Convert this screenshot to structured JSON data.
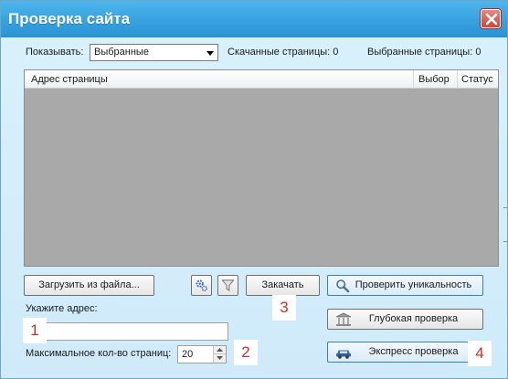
{
  "window": {
    "title": "Проверка сайта"
  },
  "filter": {
    "label": "Показывать:",
    "selected": "Выбранные"
  },
  "counters": {
    "downloaded": "Скачанные страницы: 0",
    "selected": "Выбранные страницы: 0"
  },
  "list": {
    "columns": [
      "Адрес страницы",
      "Выбор",
      "Статус"
    ]
  },
  "buttons": {
    "load_from_file": "Загрузить из файла...",
    "download": "Закачать",
    "check_uniqueness": "Проверить уникальность",
    "deep_check": "Глубокая проверка",
    "express_check": "Экспресс проверка"
  },
  "address": {
    "label": "Укажите адрес:",
    "value": ""
  },
  "max_pages": {
    "label": "Максимальное кол-во страниц:",
    "value": "20"
  },
  "annotations": [
    "1",
    "2",
    "3",
    "4"
  ],
  "colors": {
    "titlebar": "#37a2e0",
    "close": "#c9463a",
    "list_bg": "#a9a9a9",
    "annotation": "#d22c2c"
  },
  "icons": {
    "close": "close-icon",
    "settings": "gear-icon",
    "filter": "filter-icon",
    "check_uniqueness": "magnifier-icon",
    "deep_check": "bank-icon",
    "express_check": "car-icon",
    "dropdown": "chevron-down-icon"
  }
}
